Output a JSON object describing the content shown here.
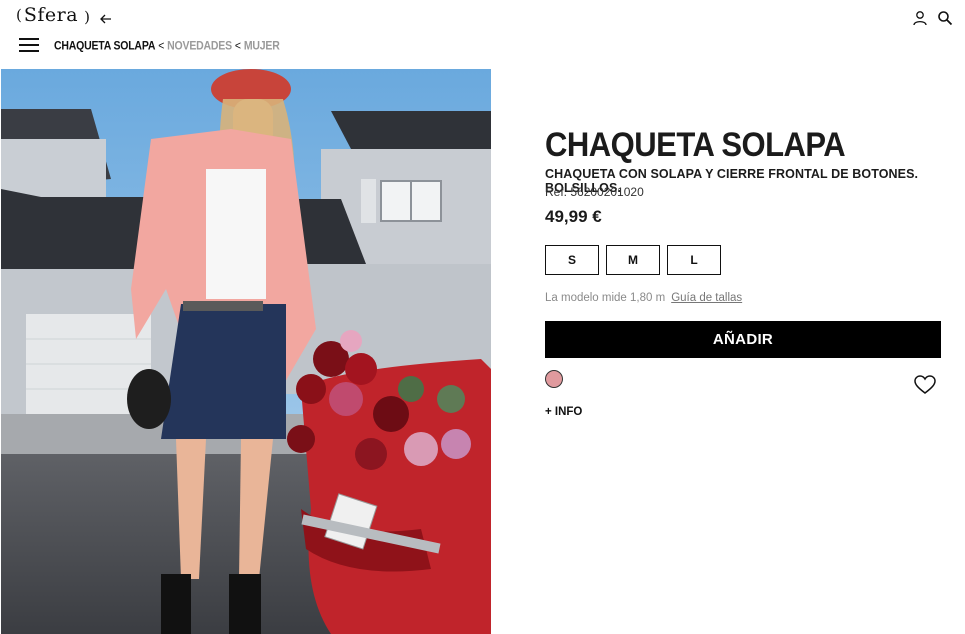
{
  "header": {
    "logo_text": "Sfera",
    "icons": [
      "back-arrow-icon",
      "user-icon",
      "search-icon",
      "menu-icon"
    ]
  },
  "breadcrumb": {
    "current": "CHAQUETA SOLAPA",
    "separator": "<",
    "items": [
      "NOVEDADES",
      "MUJER"
    ]
  },
  "product": {
    "title": "CHAQUETA SOLAPA",
    "description": "CHAQUETA CON SOLAPA Y CIERRE FRONTAL DE BOTONES. BOLSILLOS.",
    "ref": "Ref. 56200201020",
    "price": "49,99 €",
    "sizes": [
      "S",
      "M",
      "L"
    ],
    "model_info": "La modelo mide 1,80 m",
    "size_guide": "Guía de tallas",
    "add_button": "AÑADIR",
    "color_swatch": "#e09a9e",
    "more_info": "+ INFO"
  },
  "colors": {
    "accent": "#000000",
    "muted_text": "#8a8a8a",
    "breadcrumb_link": "#9a9a9a"
  }
}
